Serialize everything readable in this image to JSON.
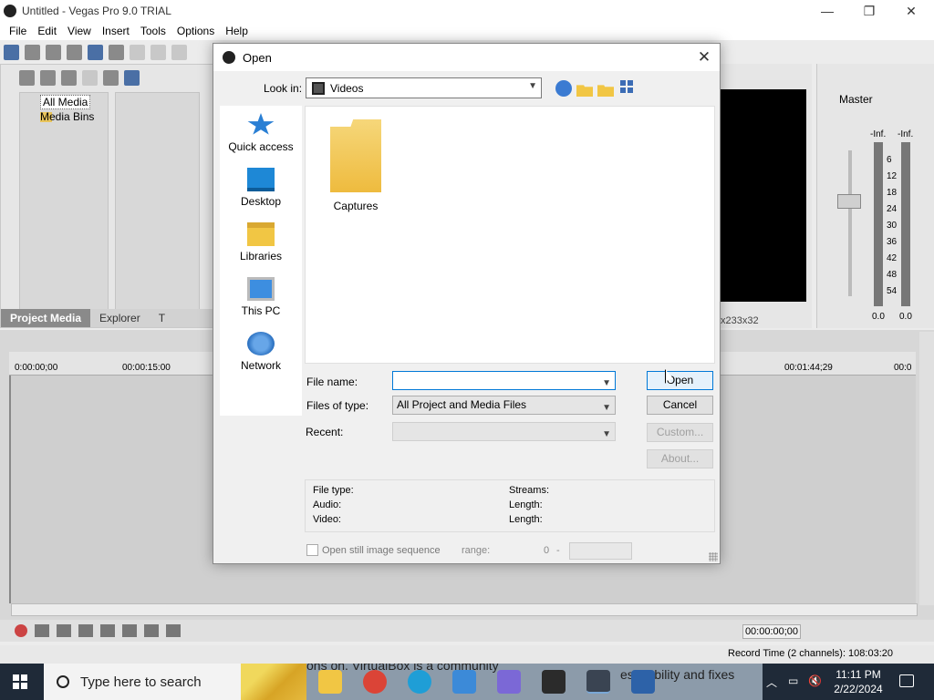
{
  "app": {
    "title": "Untitled - Vegas Pro 9.0 TRIAL",
    "menu": [
      "File",
      "Edit",
      "View",
      "Insert",
      "Tools",
      "Options",
      "Help"
    ],
    "window_controls": [
      "—",
      "❐",
      "✕"
    ]
  },
  "project_media": {
    "tree": [
      "All Media",
      "Media Bins"
    ],
    "tabs": [
      "Project Media",
      "Explorer",
      "T"
    ]
  },
  "preview": {
    "resolution": "x233x32"
  },
  "mixer": {
    "label": "Master",
    "db_scale": [
      "6",
      "12",
      "18",
      "24",
      "30",
      "36",
      "42",
      "48",
      "54"
    ],
    "inf_left": "-Inf.",
    "inf_right": "-Inf.",
    "peak_left": "0.0",
    "peak_right": "0.0"
  },
  "timeline": {
    "ruler": [
      "0:00:00;00",
      "00:00:15:00",
      "00:01:44;29",
      "00:0"
    ],
    "timecode": "00:00:00;00",
    "record_time": "Record Time (2 channels): 108:03:20"
  },
  "dialog": {
    "title": "Open",
    "look_in_label": "Look in:",
    "look_in_value": "Videos",
    "places": [
      "Quick access",
      "Desktop",
      "Libraries",
      "This PC",
      "Network"
    ],
    "files": [
      {
        "name": "Captures",
        "type": "folder"
      }
    ],
    "file_name_label": "File name:",
    "file_name_value": "",
    "files_of_type_label": "Files of type:",
    "files_of_type_value": "All Project and Media Files",
    "recent_label": "Recent:",
    "recent_value": "",
    "buttons": {
      "open": "Open",
      "cancel": "Cancel",
      "custom": "Custom...",
      "about": "About..."
    },
    "info": {
      "file_type": "File type:",
      "audio": "Audio:",
      "video": "Video:",
      "streams": "Streams:",
      "length1": "Length:",
      "length2": "Length:"
    },
    "still_image_sequence": "Open still image sequence",
    "range_label": "range:",
    "range_start": "0",
    "range_sep": "-"
  },
  "taskbar": {
    "search_placeholder": "Type here to search",
    "news_text_top": "ons on. VirtualBox is a community",
    "news_text_bottom": "es stability and fixes",
    "time": "11:11 PM",
    "date": "2/22/2024"
  }
}
